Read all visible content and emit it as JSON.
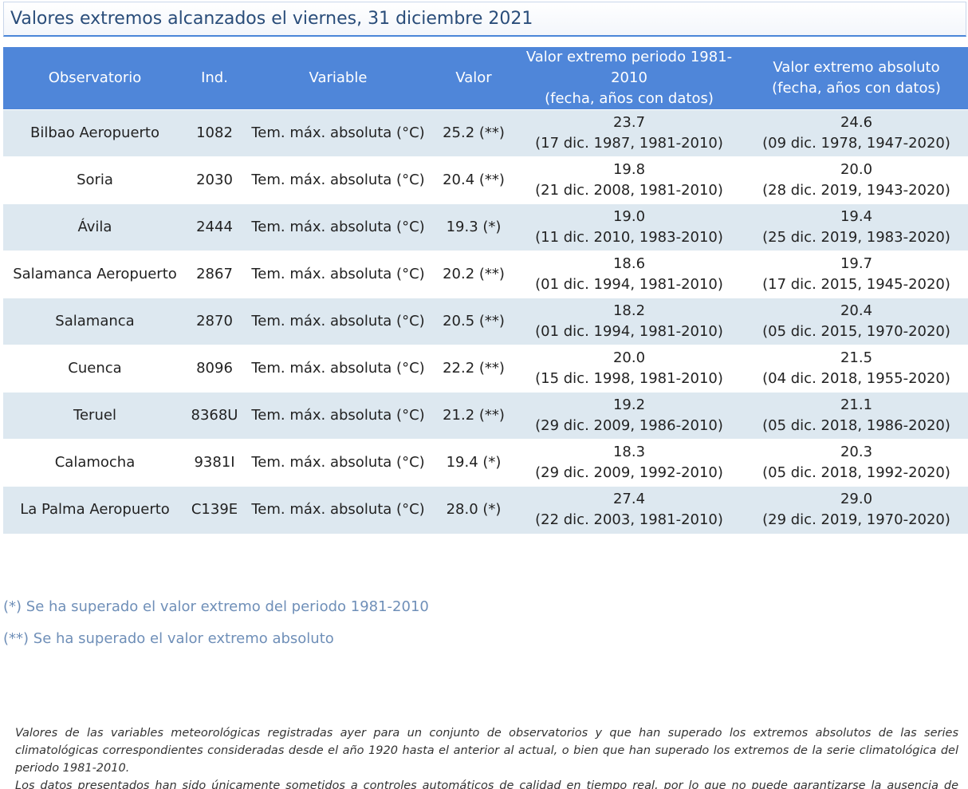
{
  "title": "Valores extremos alcanzados el viernes, 31 diciembre 2021",
  "table": {
    "headers": {
      "observatorio": "Observatorio",
      "ind": "Ind.",
      "variable": "Variable",
      "valor": "Valor",
      "periodo_line1": "Valor extremo periodo 1981-2010",
      "periodo_line2": "(fecha, años con datos)",
      "absoluto_line1": "Valor extremo absoluto",
      "absoluto_line2": "(fecha, años con datos)"
    },
    "rows": [
      {
        "observatorio": "Bilbao Aeropuerto",
        "ind": "1082",
        "variable": "Tem. máx. absoluta (°C)",
        "valor": "25.2 (**)",
        "periodo_valor": "23.7",
        "periodo_fecha": "(17 dic. 1987, 1981-2010)",
        "absoluto_valor": "24.6",
        "absoluto_fecha": "(09 dic. 1978, 1947-2020)"
      },
      {
        "observatorio": "Soria",
        "ind": "2030",
        "variable": "Tem. máx. absoluta (°C)",
        "valor": "20.4 (**)",
        "periodo_valor": "19.8",
        "periodo_fecha": "(21 dic. 2008, 1981-2010)",
        "absoluto_valor": "20.0",
        "absoluto_fecha": "(28 dic. 2019, 1943-2020)"
      },
      {
        "observatorio": "Ávila",
        "ind": "2444",
        "variable": "Tem. máx. absoluta (°C)",
        "valor": "19.3 (*)",
        "periodo_valor": "19.0",
        "periodo_fecha": "(11 dic. 2010, 1983-2010)",
        "absoluto_valor": "19.4",
        "absoluto_fecha": "(25 dic. 2019, 1983-2020)"
      },
      {
        "observatorio": "Salamanca Aeropuerto",
        "ind": "2867",
        "variable": "Tem. máx. absoluta (°C)",
        "valor": "20.2 (**)",
        "periodo_valor": "18.6",
        "periodo_fecha": "(01 dic. 1994, 1981-2010)",
        "absoluto_valor": "19.7",
        "absoluto_fecha": "(17 dic. 2015, 1945-2020)"
      },
      {
        "observatorio": "Salamanca",
        "ind": "2870",
        "variable": "Tem. máx. absoluta (°C)",
        "valor": "20.5 (**)",
        "periodo_valor": "18.2",
        "periodo_fecha": "(01 dic. 1994, 1981-2010)",
        "absoluto_valor": "20.4",
        "absoluto_fecha": "(05 dic. 2015, 1970-2020)"
      },
      {
        "observatorio": "Cuenca",
        "ind": "8096",
        "variable": "Tem. máx. absoluta (°C)",
        "valor": "22.2 (**)",
        "periodo_valor": "20.0",
        "periodo_fecha": "(15 dic. 1998, 1981-2010)",
        "absoluto_valor": "21.5",
        "absoluto_fecha": "(04 dic. 2018, 1955-2020)"
      },
      {
        "observatorio": "Teruel",
        "ind": "8368U",
        "variable": "Tem. máx. absoluta (°C)",
        "valor": "21.2 (**)",
        "periodo_valor": "19.2",
        "periodo_fecha": "(29 dic. 2009, 1986-2010)",
        "absoluto_valor": "21.1",
        "absoluto_fecha": "(05 dic. 2018, 1986-2020)"
      },
      {
        "observatorio": "Calamocha",
        "ind": "9381I",
        "variable": "Tem. máx. absoluta (°C)",
        "valor": "19.4 (*)",
        "periodo_valor": "18.3",
        "periodo_fecha": "(29 dic. 2009, 1992-2010)",
        "absoluto_valor": "20.3",
        "absoluto_fecha": "(05 dic. 2018, 1992-2020)"
      },
      {
        "observatorio": "La Palma Aeropuerto",
        "ind": "C139E",
        "variable": "Tem. máx. absoluta (°C)",
        "valor": "28.0 (*)",
        "periodo_valor": "27.4",
        "periodo_fecha": "(22 dic. 2003, 1981-2010)",
        "absoluto_valor": "29.0",
        "absoluto_fecha": "(29 dic. 2019, 1970-2020)"
      }
    ]
  },
  "footnotes": {
    "single": "(*) Se ha superado el valor extremo del periodo 1981-2010",
    "double": "(**) Se ha superado el valor extremo absoluto"
  },
  "note": {
    "line1": "Valores de las variables meteorológicas registradas ayer para un conjunto de observatorios y que han superado los extremos absolutos de las series climatológicas correspondientes consideradas desde el año 1920 hasta el anterior al actual, o bien que han superado los extremos de la serie climatológica del periodo 1981-2010.",
    "line2": "Los datos presentados han sido únicamente sometidos a controles automáticos de calidad en tiempo real, por lo que no puede garantizarse la ausencia de errores."
  },
  "colors": {
    "header_bg": "#4f86d9",
    "row_alt_bg": "#dde8f0",
    "title_text": "#2a4d7a",
    "footnote_text": "#6f8fb8"
  }
}
